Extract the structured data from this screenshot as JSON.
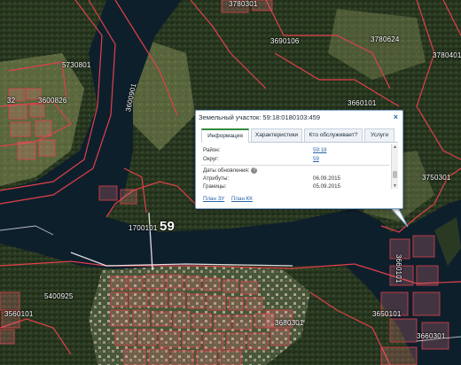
{
  "map": {
    "colors": {
      "water": "#0d1e2b",
      "forest": "#28361f",
      "forest_dark": "#1d2a18",
      "field": "#6f7b4b",
      "parcel_line": "#e0404a",
      "parcel_fill": "rgba(255,130,140,0.25)",
      "road": "#ffffff"
    },
    "labels": [
      {
        "text": "5730801",
        "kind": "normal"
      },
      {
        "text": "3600826",
        "kind": "normal"
      },
      {
        "text": "32",
        "kind": "normal"
      },
      {
        "text": "3600901",
        "kind": "vertical"
      },
      {
        "text": "3690106",
        "kind": "normal"
      },
      {
        "text": "3780624",
        "kind": "normal"
      },
      {
        "text": "3780401",
        "kind": "normal"
      },
      {
        "text": "3660101",
        "kind": "normal"
      },
      {
        "text": "3750301",
        "kind": "normal"
      },
      {
        "text": "3780301",
        "kind": "normal"
      },
      {
        "text": "1700101",
        "kind": "normal"
      },
      {
        "text": "59",
        "kind": "big"
      },
      {
        "text": "5400925",
        "kind": "normal"
      },
      {
        "text": "3560101",
        "kind": "normal"
      },
      {
        "text": "3650101",
        "kind": "normal"
      },
      {
        "text": "3660101",
        "kind": "vertical2"
      },
      {
        "text": "3660301",
        "kind": "normal"
      },
      {
        "text": "3680301",
        "kind": "normal"
      }
    ]
  },
  "popup": {
    "title": "Земельный участок: 59:18:0180103:459",
    "close_symbol": "×",
    "tabs": [
      {
        "label": "Информация",
        "active": true
      },
      {
        "label": "Характеристики",
        "active": false
      },
      {
        "label": "Кто обслуживает?",
        "active": false
      },
      {
        "label": "Услуги",
        "active": false
      }
    ],
    "rows": [
      {
        "label": "Район:",
        "value": "59:18"
      },
      {
        "label": "Округ:",
        "value": "59"
      }
    ],
    "update_section": {
      "heading": "Даты обновления:",
      "help_symbol": "?",
      "rows": [
        {
          "label": "Атрибуты:",
          "value": "06.09.2015"
        },
        {
          "label": "Границы:",
          "value": "05.09.2015"
        }
      ]
    },
    "scroll_up": "▲",
    "scroll_down": "▼",
    "links": [
      {
        "label": "План ЗУ"
      },
      {
        "label": "План КК"
      }
    ]
  }
}
